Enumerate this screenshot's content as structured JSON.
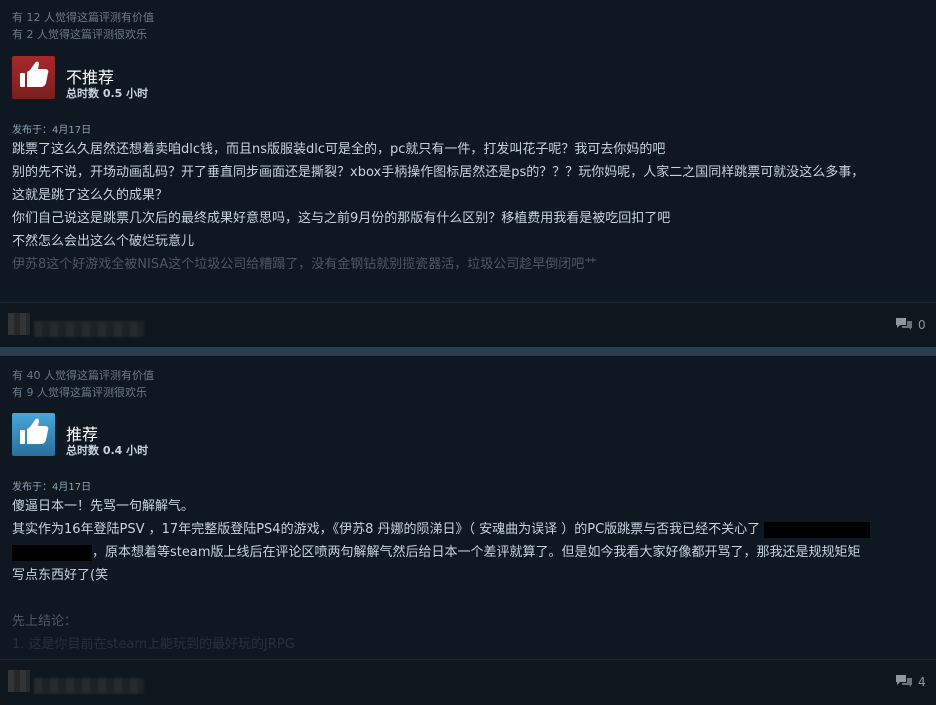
{
  "reviews": [
    {
      "helpful_line": "有 12 人觉得这篇评测有价值",
      "funny_line": "有 2 人觉得这篇评测很欢乐",
      "recommendation": "不推荐",
      "hours": "总时数 0.5 小时",
      "posted": "发布于：4月17日",
      "lines": [
        "跳票了这么久居然还想着卖咱dlc钱，而且ns版服装dlc可是全的，pc就只有一件，打发叫花子呢？我可去你妈的吧",
        "别的先不说，开场动画乱码？开了垂直同步画面还是撕裂？xbox手柄操作图标居然还是ps的？？？玩你妈呢，人家二之国同样跳票可就没这么多事，",
        "这就是跳了这么久的成果？",
        "你们自己说这是跳票几次后的最终成果好意思吗，这与之前9月份的那版有什么区别？移植费用我看是被吃回扣了吧",
        "不然怎么会出这么个破烂玩意儿",
        "伊苏8这个好游戏全被NISA这个垃圾公司给糟蹋了，没有金钢钻就别揽瓷器活，垃圾公司趁早倒闭吧艹"
      ],
      "comment_count": "0",
      "thumb_icon": "thumbs-down-icon"
    },
    {
      "helpful_line": "有 40 人觉得这篇评测有价值",
      "funny_line": "有 9 人觉得这篇评测很欢乐",
      "recommendation": "推荐",
      "hours": "总时数 0.4 小时",
      "posted": "发布于：4月17日",
      "line1": "傻逼日本一！先骂一句解解气。",
      "line2a": "其实作为16年登陆PSV ，17年完整版登陆PS4的游戏，《伊苏8 丹娜的陨涕日》（ 安魂曲为误译 ）的PC版跳票与否我已经不关心了",
      "line2b": "，原本想着等steam版上线后在评论区喷两句解解气然后给日本一个差评就算了。但是如今我看大家好像都开骂了，那我还是规规矩矩",
      "line2c": "写点东西好了(笑",
      "line3": "先上结论：",
      "line4": "1. 这是你目前在steam上能玩到的最好玩的JRPG",
      "comment_count": "4",
      "thumb_icon": "thumbs-up-icon"
    }
  ],
  "colors": {
    "negative": "#a7282a",
    "positive": "#4aa6d9",
    "card_bg": "#0f1720"
  }
}
